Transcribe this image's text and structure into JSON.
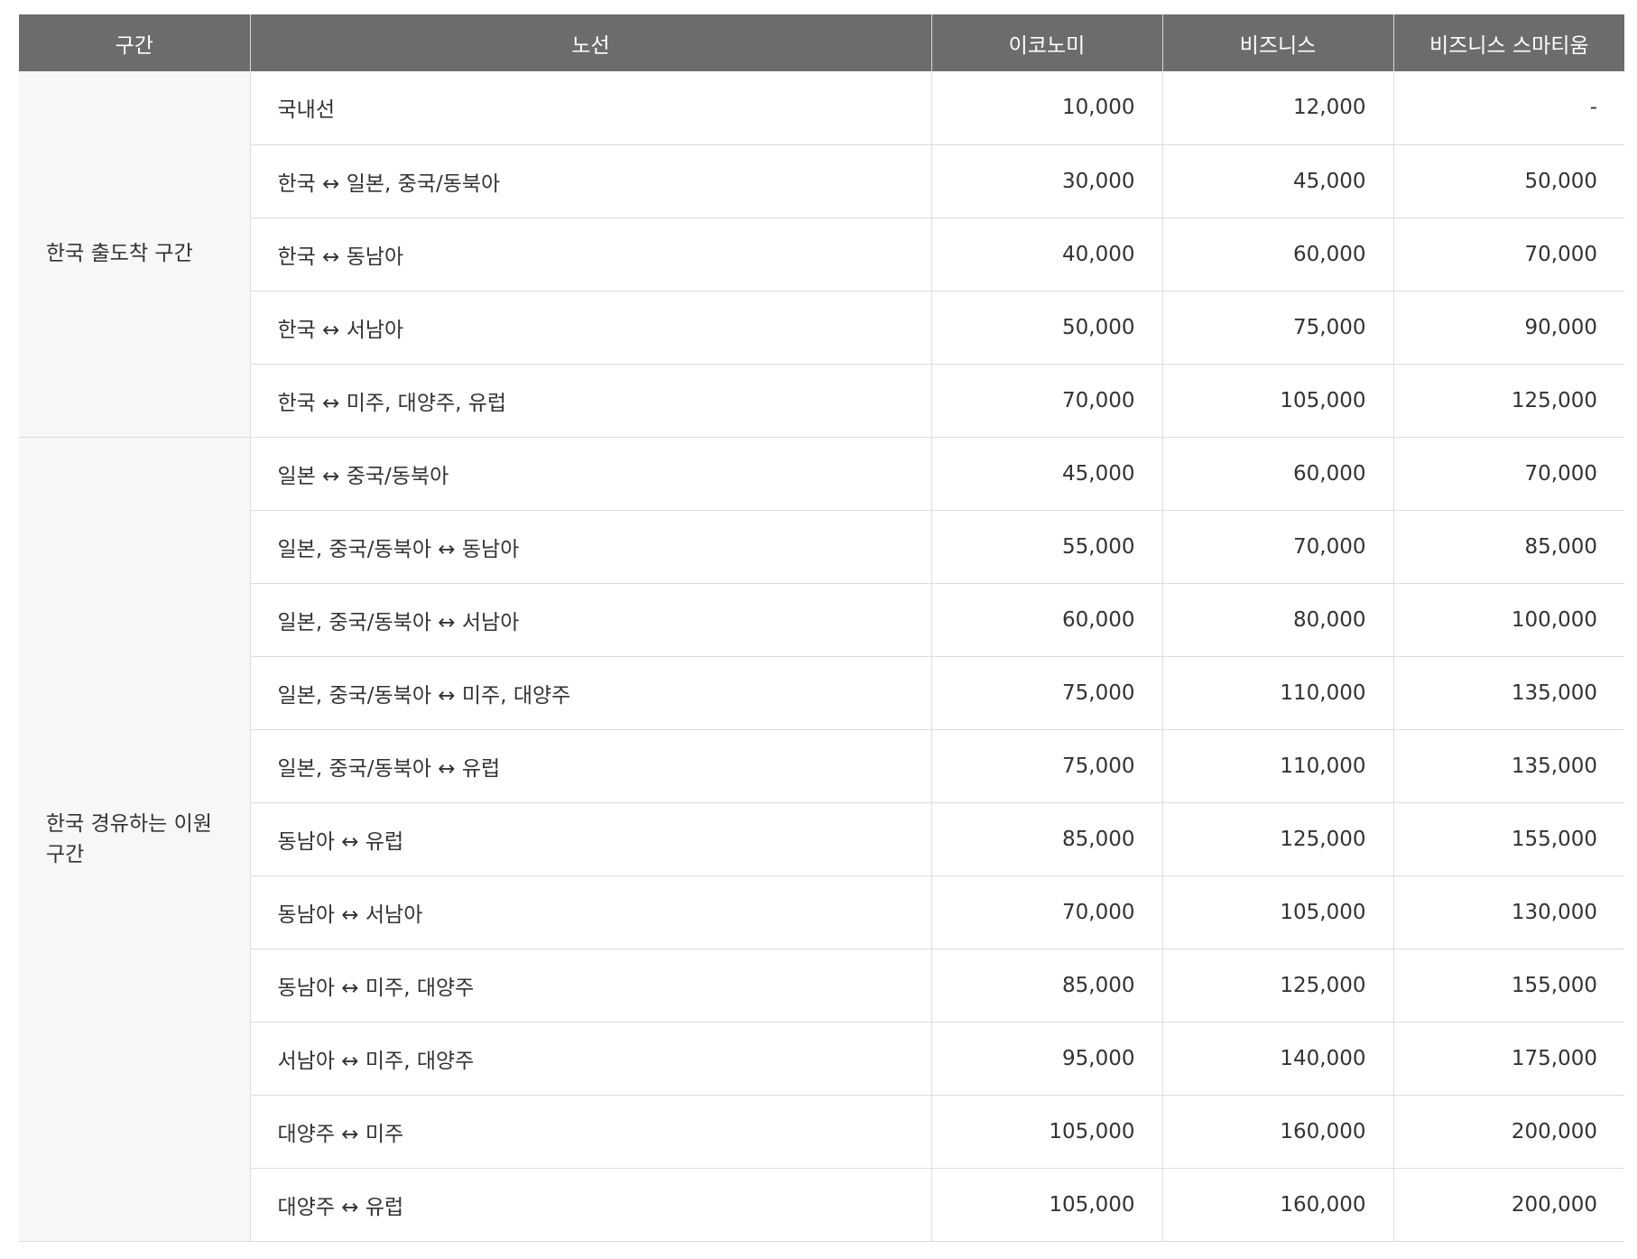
{
  "headers": {
    "section": "구간",
    "route": "노선",
    "economy": "이코노미",
    "business": "비즈니스",
    "smartium": "비즈니스 스마티움"
  },
  "groups": [
    {
      "label": "한국 출도착 구간",
      "rows": [
        {
          "route": "국내선",
          "economy": "10,000",
          "business": "12,000",
          "smartium": "-"
        },
        {
          "route": "한국 ↔ 일본, 중국/동북아",
          "economy": "30,000",
          "business": "45,000",
          "smartium": "50,000"
        },
        {
          "route": "한국 ↔ 동남아",
          "economy": "40,000",
          "business": "60,000",
          "smartium": "70,000"
        },
        {
          "route": "한국 ↔ 서남아",
          "economy": "50,000",
          "business": "75,000",
          "smartium": "90,000"
        },
        {
          "route": "한국 ↔ 미주, 대양주, 유럽",
          "economy": "70,000",
          "business": "105,000",
          "smartium": "125,000"
        }
      ]
    },
    {
      "label": "한국 경유하는 이원구간",
      "rows": [
        {
          "route": "일본 ↔ 중국/동북아",
          "economy": "45,000",
          "business": "60,000",
          "smartium": "70,000"
        },
        {
          "route": "일본, 중국/동북아 ↔ 동남아",
          "economy": "55,000",
          "business": "70,000",
          "smartium": "85,000"
        },
        {
          "route": "일본, 중국/동북아 ↔ 서남아",
          "economy": "60,000",
          "business": "80,000",
          "smartium": "100,000"
        },
        {
          "route": "일본, 중국/동북아 ↔ 미주, 대양주",
          "economy": "75,000",
          "business": "110,000",
          "smartium": "135,000"
        },
        {
          "route": "일본, 중국/동북아 ↔ 유럽",
          "economy": "75,000",
          "business": "110,000",
          "smartium": "135,000"
        },
        {
          "route": "동남아 ↔ 유럽",
          "economy": "85,000",
          "business": "125,000",
          "smartium": "155,000"
        },
        {
          "route": "동남아 ↔ 서남아",
          "economy": "70,000",
          "business": "105,000",
          "smartium": "130,000"
        },
        {
          "route": "동남아 ↔ 미주, 대양주",
          "economy": "85,000",
          "business": "125,000",
          "smartium": "155,000"
        },
        {
          "route": "서남아 ↔ 미주, 대양주",
          "economy": "95,000",
          "business": "140,000",
          "smartium": "175,000"
        },
        {
          "route": "대양주 ↔ 미주",
          "economy": "105,000",
          "business": "160,000",
          "smartium": "200,000"
        },
        {
          "route": "대양주 ↔ 유럽",
          "economy": "105,000",
          "business": "160,000",
          "smartium": "200,000"
        }
      ]
    }
  ]
}
